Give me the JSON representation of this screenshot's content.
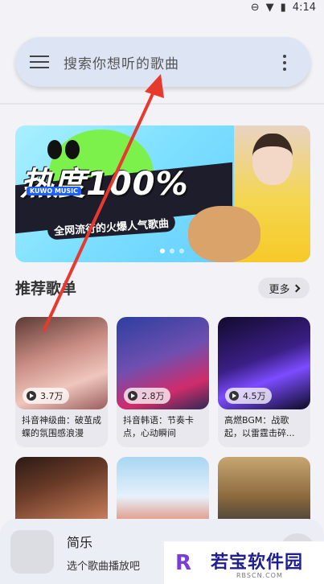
{
  "status_bar": {
    "time": "4:14"
  },
  "search": {
    "placeholder": "搜索你想听的歌曲"
  },
  "banner": {
    "headline": "热度100%",
    "brand": "KUWO MUSIC",
    "subtitle": "全网流行的火爆人气歌曲",
    "page_count": 3,
    "active_page": 1
  },
  "recommend": {
    "title": "推荐歌单",
    "more_label": "更多",
    "playlists": [
      {
        "plays": "3.7万",
        "title": "抖音神级曲：破茧成蝶的氛围感浪漫"
      },
      {
        "plays": "2.8万",
        "title": "抖音韩语：节奏卡点，心动瞬间"
      },
      {
        "plays": "4.5万",
        "title": "高燃BGM：战歌起，以雷霆击碎..."
      }
    ]
  },
  "player": {
    "name": "简乐",
    "desc": "选个歌曲播放吧"
  },
  "watermark": {
    "name": "若宝软件园",
    "domain": "RBSCN.COM"
  },
  "colors": {
    "accent_arrow": "#e8392f",
    "search_bg": "#dde4f3",
    "banner_bg": "#7fe0ff"
  }
}
